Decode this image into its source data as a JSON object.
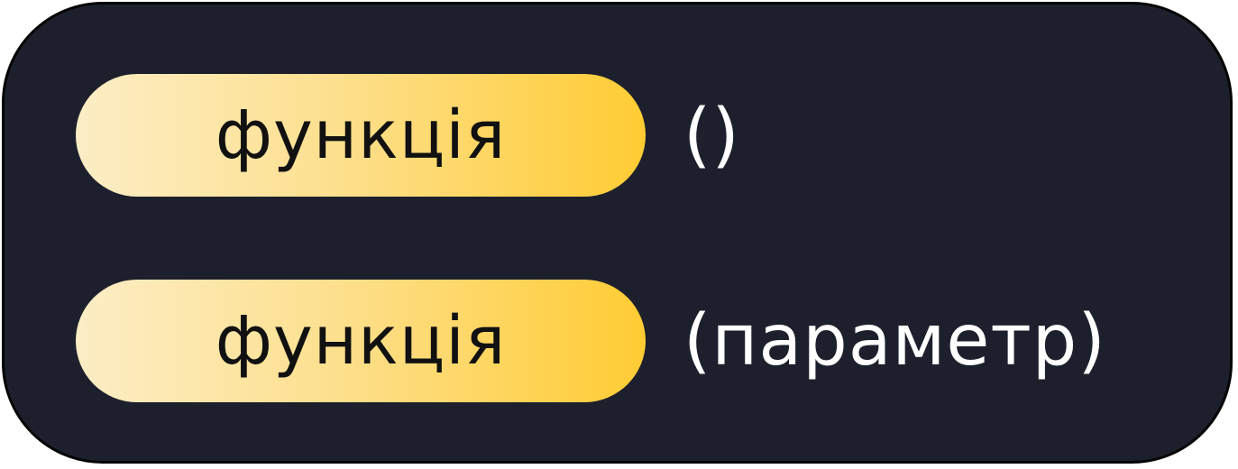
{
  "rows": [
    {
      "function_label": "функція",
      "arguments": "()"
    },
    {
      "function_label": "функція",
      "arguments": "(параметр)"
    }
  ],
  "colors": {
    "card_background": "#1d202c",
    "pill_gradient_start": "#fcedc5",
    "pill_gradient_end": "#ffcc33",
    "argument_text": "#ffffff"
  }
}
